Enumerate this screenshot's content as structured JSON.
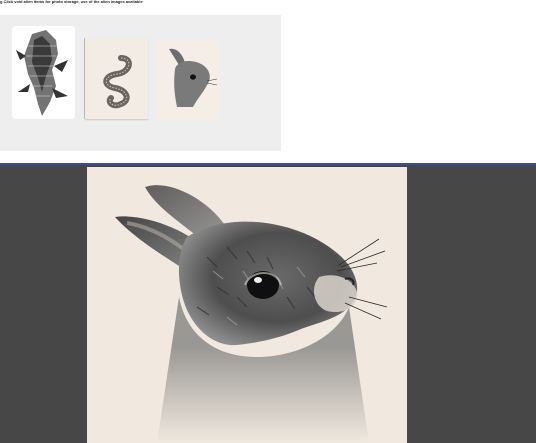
{
  "page": {
    "instruction_text": "g Click void alien items for photo storage, use of the alien images available"
  },
  "thumbnails": [
    {
      "subject": "alligator sketch"
    },
    {
      "subject": "worm sketch"
    },
    {
      "subject": "rabbit sketch"
    }
  ],
  "viewer": {
    "image_subject": "rabbit sketch"
  },
  "colors": {
    "thumb_strip_bg": "#eeeeee",
    "viewer_bg": "#474747",
    "divider": "#3a4aa8",
    "paper": "#f1e9df"
  }
}
